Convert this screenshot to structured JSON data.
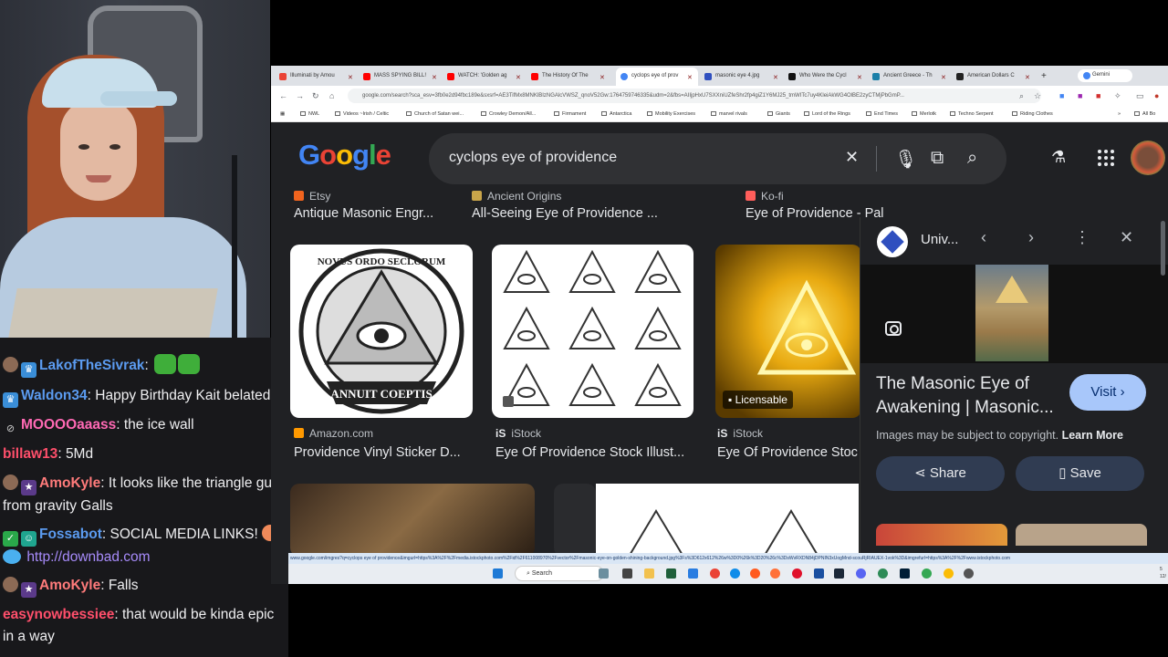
{
  "chat": {
    "messages": [
      {
        "user": "LakofTheSivrak",
        "sep": ":",
        "text": "",
        "color": "#5b9bf0",
        "badges": [
          "avatar",
          "sub"
        ],
        "emotes": 2
      },
      {
        "user": "Waldon34",
        "sep": ":",
        "text": "Happy Birthday Kait belated",
        "color": "#5b9bf0",
        "badges": [
          "sub"
        ]
      },
      {
        "user": "MOOOOaaass",
        "sep": ":",
        "text": "the ice wall",
        "color": "#ff69b4",
        "badges": [
          "mute"
        ]
      },
      {
        "user": "billaw13",
        "sep": ":",
        "text": "5Md",
        "color": "#ff4f6b",
        "badges": []
      },
      {
        "user": "AmoKyle",
        "sep": ":",
        "text": "It looks like the triangle guy from gravity Galls",
        "color": "#ff7b7b",
        "badges": [
          "avatar",
          "cat"
        ]
      },
      {
        "user": "Fossabot",
        "sep": ":",
        "text": "SOCIAL MEDIA LINKS!",
        "link": "http://downbad.com",
        "color": "#5b9bf0",
        "badges": [
          "vip",
          "bot"
        ]
      },
      {
        "user": "AmoKyle",
        "sep": ":",
        "text": "Falls",
        "color": "#ff7b7b",
        "badges": [
          "avatar",
          "cat"
        ]
      },
      {
        "user": "easynowbessiee",
        "sep": ":",
        "text": "that would be kinda epic in a way",
        "color": "#ff4f6b",
        "badges": []
      }
    ]
  },
  "browser": {
    "tabs": [
      {
        "label": "Illuminati by Amou",
        "color": "#ea4335"
      },
      {
        "label": "MASS SPYING BILL!",
        "color": "#ff0000"
      },
      {
        "label": "WATCH: 'Golden ag",
        "color": "#ff0000"
      },
      {
        "label": "The History Of The",
        "color": "#ff0000"
      },
      {
        "label": "cyclops eye of prov",
        "color": "#4285f4",
        "active": true
      },
      {
        "label": "masonic eye 4.jpg",
        "color": "#2f4fbf"
      },
      {
        "label": "Who Were the Cycl",
        "color": "#111111"
      },
      {
        "label": "Ancient Greece - Th",
        "color": "#1a7fa8"
      },
      {
        "label": "American Dollars C",
        "color": "#222222"
      }
    ],
    "gemini_label": "Gemini",
    "new_tab": "+",
    "url": "google.com/search?sca_esv=3fb0e2d94fbc189e&sxsrf=AE3TifMx8MNKlBIzNGAlcVWSZ_qnoV52Gw:1764759746335&udm=2&fbs=AIIjpHxU7SXXniUZfeShr2fp4giZ1Y6MJ25_tmWITc7uy4KleiAkWG4OlBE2zyCTMjPbGmP...",
    "bookmarks": [
      "NWL",
      "Videos ~Irish / Celtic",
      "Church of Satan wei...",
      "Crowley Demon/All...",
      "Firmament",
      "Antarctica",
      "Mobility Exercises",
      "marvel rivals",
      "Giants",
      "Lord of the Rings",
      "End Times",
      "Merlotk",
      "Techno Serpent",
      "Riding Clothes"
    ],
    "all_bookmarks": "All Bo"
  },
  "google": {
    "logo": "Google",
    "query": "cyclops eye of providence",
    "top_row": [
      {
        "source": "Etsy",
        "title": "Antique Masonic Engr...",
        "icon_color": "#f1641e"
      },
      {
        "source": "Ancient Origins",
        "title": "All-Seeing Eye of Providence ...",
        "icon_color": "#c9a54a"
      },
      {
        "source": "Ko-fi",
        "title": "Eye of Providence - Pal",
        "icon_color": "#ff5e5b"
      }
    ],
    "results": [
      {
        "source": "Amazon.com",
        "title": "Providence Vinyl Sticker D...",
        "icon_color": "#ff9900",
        "seal_top": "NOVUS ORDO SECLORUM",
        "seal_bottom": "ANNUIT COEPTIS"
      },
      {
        "source": "iStock",
        "title": "Eye Of Providence Stock Illust...",
        "icon_color": "#e8eaed"
      },
      {
        "source": "iStock",
        "title": "Eye Of Providence Stoc",
        "icon_color": "#e8eaed",
        "badge": "Licensable"
      }
    ]
  },
  "panel": {
    "site": "Univ...",
    "title": "The Masonic Eye of Awakening | Masonic...",
    "visit": "Visit",
    "copyright_text": "Images may be subject to copyright.",
    "learn_more": "Learn More",
    "share": "Share",
    "save": "Save"
  },
  "status_url": "www.google.com/imgres?q=cyclops eye of providence&imgurl=https%3A%2F%2Fmedia.istockphoto.com%2Fid%2F611008970%2Fvector%2Fmasonic-eye-on-golden-shining-background.jpg%3Fs%3D612x612%26w%3D0%26k%3D20%26c%3DsWvRXDN84jDPNIN3xUogMnd-scouRjRIAUEX-1vok%3D&imgrefurl=https%3A%2F%2Fwww.istockphoto.com",
  "taskbar": {
    "search_label": "Search",
    "clock": "5\n12/"
  }
}
